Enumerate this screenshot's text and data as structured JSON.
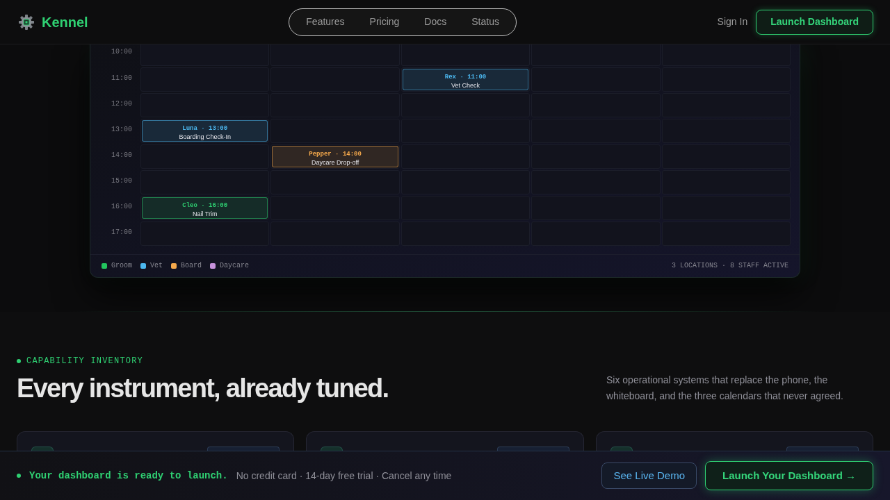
{
  "header": {
    "brand": "Kennel",
    "nav": [
      {
        "label": "Features"
      },
      {
        "label": "Pricing"
      },
      {
        "label": "Docs"
      },
      {
        "label": "Status"
      }
    ],
    "sign_in": "Sign In",
    "cta": "Launch Dashboard"
  },
  "schedule": {
    "rows": [
      {
        "time": "10:00",
        "cells": [
          null,
          null,
          null,
          null,
          null
        ]
      },
      {
        "time": "11:00",
        "cells": [
          null,
          null,
          {
            "title": "Rex · 11:00",
            "service": "Vet Check",
            "color": "#4cb8f0"
          },
          null,
          null
        ]
      },
      {
        "time": "12:00",
        "cells": [
          null,
          null,
          null,
          null,
          null
        ]
      },
      {
        "time": "13:00",
        "cells": [
          {
            "title": "Luna · 13:00",
            "service": "Boarding Check-In",
            "color": "#4cb8f0"
          },
          null,
          null,
          null,
          null
        ]
      },
      {
        "time": "14:00",
        "cells": [
          null,
          {
            "title": "Pepper · 14:00",
            "service": "Daycare Drop-off",
            "color": "#f5a94c"
          },
          null,
          null,
          null
        ]
      },
      {
        "time": "15:00",
        "cells": [
          null,
          null,
          null,
          null,
          null
        ]
      },
      {
        "time": "16:00",
        "cells": [
          {
            "title": "Cleo · 16:00",
            "service": "Nail Trim",
            "color": "#2fd072"
          },
          null,
          null,
          null,
          null
        ]
      },
      {
        "time": "17:00",
        "cells": [
          null,
          null,
          null,
          null,
          null
        ]
      }
    ],
    "legend": [
      {
        "label": "Groom",
        "color": "#22c55e"
      },
      {
        "label": "Vet",
        "color": "#4cb8f0"
      },
      {
        "label": "Board",
        "color": "#f5a94c"
      },
      {
        "label": "Daycare",
        "color": "#c792dc"
      }
    ],
    "summary": "3 LOCATIONS · 8 STAFF ACTIVE"
  },
  "capabilities": {
    "eyebrow": "CAPABILITY INVENTORY",
    "title": "Every instrument, already tuned.",
    "description": "Six operational systems that replace the phone, the whiteboard, and the three calendars that never agreed."
  },
  "launch_bar": {
    "message": "Your dashboard is ready to launch.",
    "note": "No credit card · 14-day free trial · Cancel any time",
    "buttons": [
      {
        "label": "See Live Demo",
        "kind": "secondary"
      },
      {
        "label": "Launch Your Dashboard →",
        "kind": "primary"
      }
    ]
  }
}
